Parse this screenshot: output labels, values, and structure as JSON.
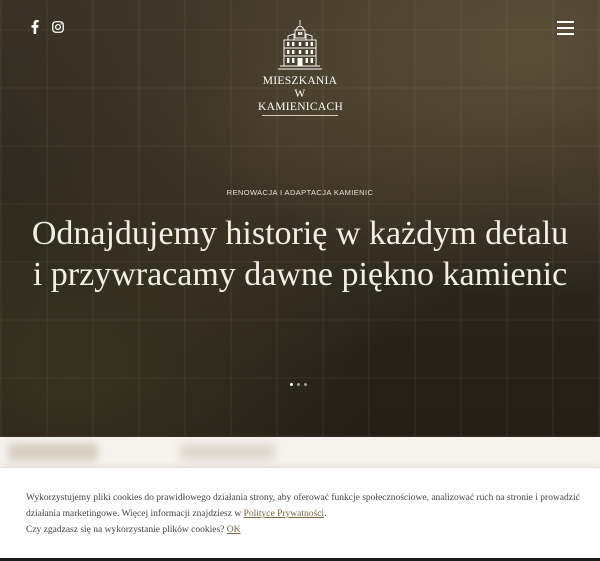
{
  "header": {
    "social": [
      {
        "icon": "facebook-icon"
      },
      {
        "icon": "instagram-icon"
      }
    ],
    "menu_icon": "hamburger-menu-icon",
    "logo": {
      "line1": "MIESZKANIA",
      "line2": "W KAMIENICACH",
      "emblem": "tenement-building-emblem"
    }
  },
  "hero": {
    "kicker": "RENOWACJA I ADAPTACJA KAMIENIC",
    "headline_line1": "Odnajdujemy historię w każdym detalu",
    "headline_line2": "i przywracamy dawne piękno kamienic",
    "slider": {
      "count": 3,
      "active_index": 1
    }
  },
  "cookie": {
    "text_before_link": "Wykorzystujemy pliki cookies do prawidłowego działania strony, aby oferować funkcje społecznościowe, analizować ruch na stronie i prowadzić działania marketingowe. Więcej informacji znajdziesz w ",
    "link_text": "Polityce Prywatności",
    "text_after_link": ".",
    "question": "Czy zgadzasz się na wykorzystanie plików cookies? ",
    "accept_label": "OK"
  },
  "colors": {
    "hero_overlay": "#2f291e",
    "text_light": "#f3efe6",
    "link": "#7a6440",
    "cookie_bg": "#ffffff"
  }
}
